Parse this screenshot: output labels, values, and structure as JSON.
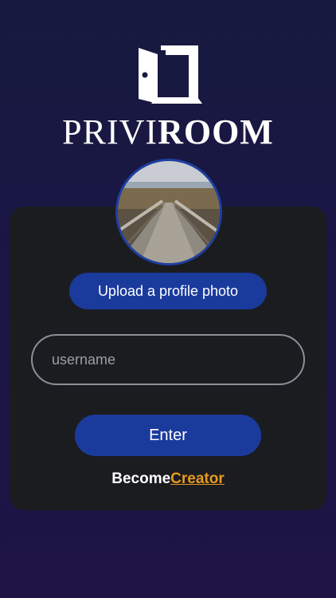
{
  "brand": {
    "name_light": "PRIVI",
    "name_bold": "ROOM",
    "logo_icon": "door-icon"
  },
  "profile": {
    "avatar_alt": "profile photo",
    "upload_label": "Upload a profile photo"
  },
  "form": {
    "username_placeholder": "username",
    "username_value": "",
    "enter_label": "Enter"
  },
  "footer": {
    "become_prefix": "Become",
    "become_link": "Creator"
  },
  "colors": {
    "accent": "#1a3a9c",
    "link": "#e69a1e",
    "card": "#1b1c20"
  }
}
